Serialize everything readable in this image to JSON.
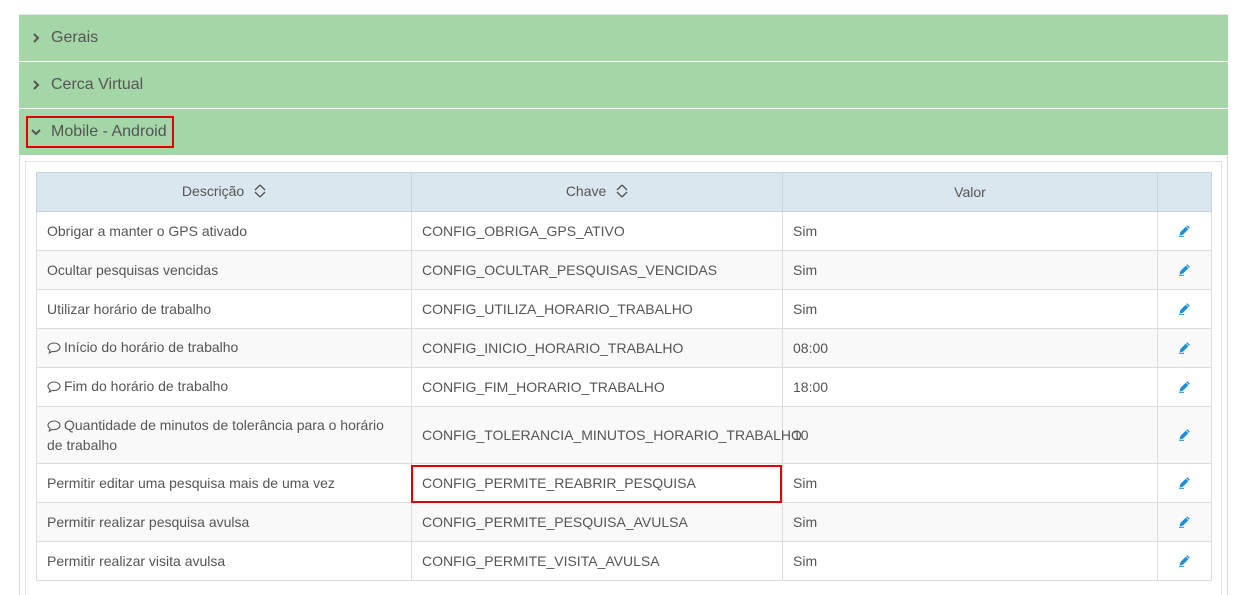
{
  "accordion": {
    "sections": [
      {
        "title": "Gerais",
        "expanded": false
      },
      {
        "title": "Cerca Virtual",
        "expanded": false
      },
      {
        "title": "Mobile - Android",
        "expanded": true
      }
    ]
  },
  "table": {
    "columns": {
      "descricao": "Descrição",
      "chave": "Chave",
      "valor": "Valor"
    },
    "rows": [
      {
        "descricao": "Obrigar a manter o GPS ativado",
        "chave": "CONFIG_OBRIGA_GPS_ATIVO",
        "valor": "Sim",
        "comment": false
      },
      {
        "descricao": "Ocultar pesquisas vencidas",
        "chave": "CONFIG_OCULTAR_PESQUISAS_VENCIDAS",
        "valor": "Sim",
        "comment": false
      },
      {
        "descricao": "Utilizar horário de trabalho",
        "chave": "CONFIG_UTILIZA_HORARIO_TRABALHO",
        "valor": "Sim",
        "comment": false
      },
      {
        "descricao": "Início do horário de trabalho",
        "chave": "CONFIG_INICIO_HORARIO_TRABALHO",
        "valor": "08:00",
        "comment": true
      },
      {
        "descricao": "Fim do horário de trabalho",
        "chave": "CONFIG_FIM_HORARIO_TRABALHO",
        "valor": "18:00",
        "comment": true
      },
      {
        "descricao": "Quantidade de minutos de tolerância para o horário de trabalho",
        "chave": "CONFIG_TOLERANCIA_MINUTOS_HORARIO_TRABALHO",
        "valor": "10",
        "comment": true
      },
      {
        "descricao": "Permitir editar uma pesquisa mais de uma vez",
        "chave": "CONFIG_PERMITE_REABRIR_PESQUISA",
        "valor": "Sim",
        "comment": false
      },
      {
        "descricao": "Permitir realizar pesquisa avulsa",
        "chave": "CONFIG_PERMITE_PESQUISA_AVULSA",
        "valor": "Sim",
        "comment": false
      },
      {
        "descricao": "Permitir realizar visita avulsa",
        "chave": "CONFIG_PERMITE_VISITA_AVULSA",
        "valor": "Sim",
        "comment": false
      }
    ]
  },
  "colors": {
    "accordion_header": "#a5d6a7",
    "table_header": "#dae7ef",
    "highlight": "#e00000",
    "edit_icon": "#1a8fd8"
  }
}
